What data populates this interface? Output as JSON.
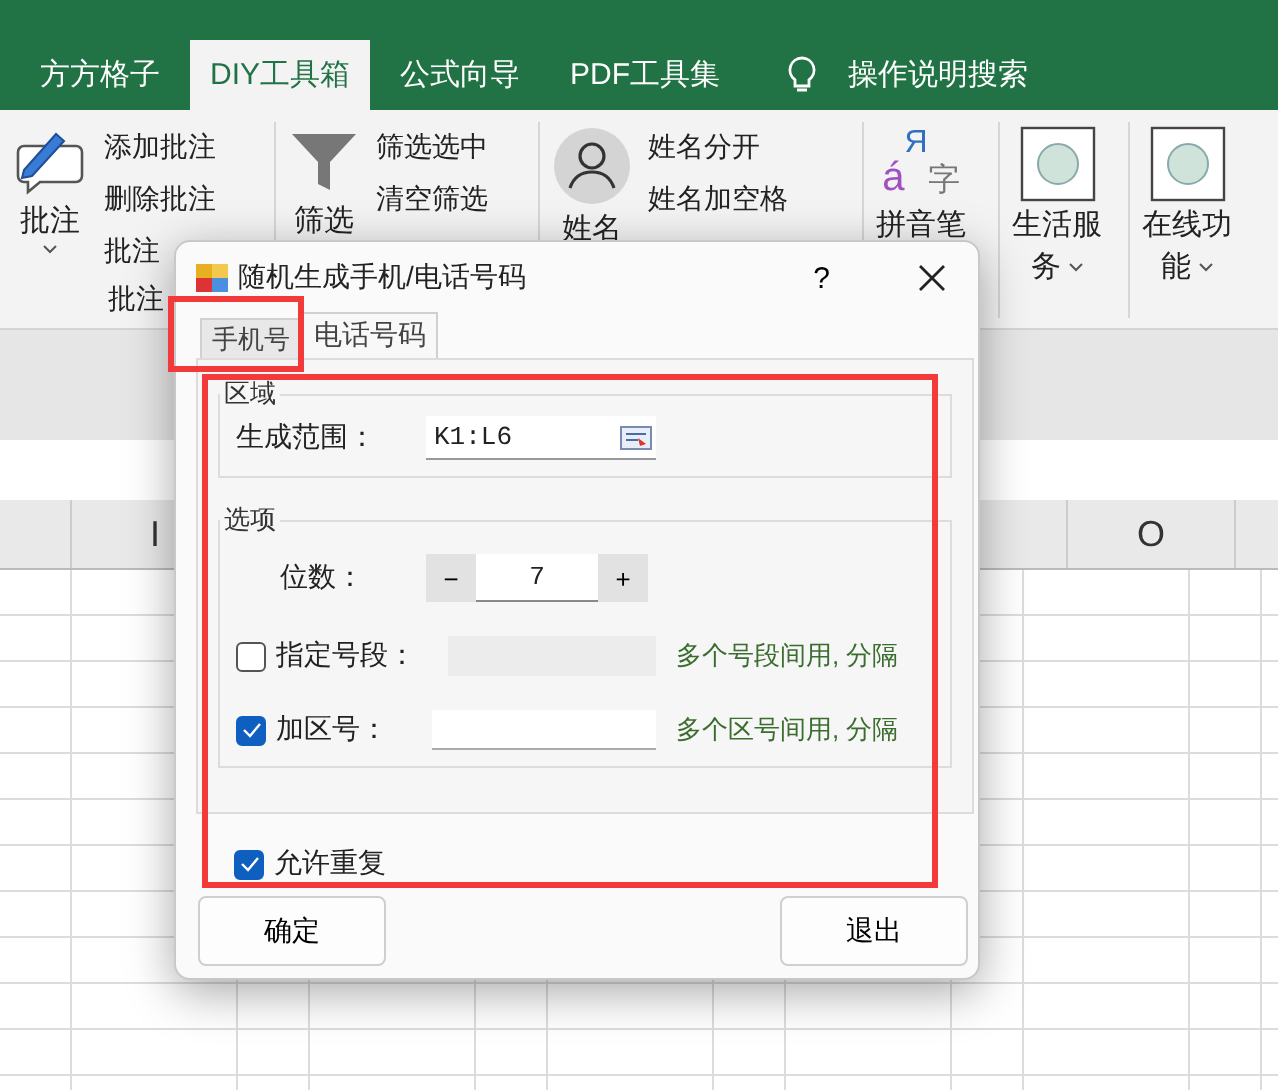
{
  "ribbon_tabs": [
    {
      "label": "方方格子",
      "selected": false
    },
    {
      "label": "DIY工具箱",
      "selected": true
    },
    {
      "label": "公式向导",
      "selected": false
    },
    {
      "label": "PDF工具集",
      "selected": false
    }
  ],
  "tell_me": {
    "label": "操作说明搜索"
  },
  "ribbon_groups": [
    {
      "kind": "comment",
      "label_lines": [
        "批注"
      ],
      "dropdown": true,
      "items": [
        "添加批注",
        "删除批注",
        "批注"
      ],
      "group_label": "批注"
    },
    {
      "kind": "filter",
      "label_lines": [
        "筛选"
      ],
      "dropdown": false,
      "items": [
        "筛选选中",
        "清空筛选"
      ]
    },
    {
      "kind": "name",
      "label_lines": [
        "姓名"
      ],
      "items": [
        "姓名分开",
        "姓名加空格"
      ]
    },
    {
      "kind": "pinyin",
      "label_lines": [
        "拼音笔"
      ],
      "icon_text": [
        "á",
        "Я",
        "字"
      ]
    },
    {
      "kind": "menu",
      "label_lines": [
        "生活服",
        "务"
      ],
      "dropdown": true
    },
    {
      "kind": "menu",
      "label_lines": [
        "在线功",
        "能"
      ],
      "dropdown": true
    }
  ],
  "column_headers": [
    "I",
    "O"
  ],
  "dialog": {
    "title": "随机生成手机/电话号码",
    "help": "?",
    "tabs": [
      {
        "label": "手机号",
        "selected": false
      },
      {
        "label": "电话号码",
        "selected": true
      }
    ],
    "area_group": {
      "legend": "区域",
      "range_label": "生成范围：",
      "range_value": "K1:L6"
    },
    "options_group": {
      "legend": "选项",
      "digits_label": "位数：",
      "digits_value": "7",
      "decrement": "−",
      "increment": "+",
      "rows": [
        {
          "label": "指定号段：",
          "checked": false,
          "disabled": true,
          "hint": "多个号段间用, 分隔"
        },
        {
          "label": "加区号：",
          "checked": true,
          "disabled": false,
          "hint": "多个区号间用, 分隔"
        }
      ]
    },
    "allow_repeat": {
      "label": "允许重复",
      "checked": true
    },
    "buttons": [
      "确定",
      "退出"
    ]
  }
}
